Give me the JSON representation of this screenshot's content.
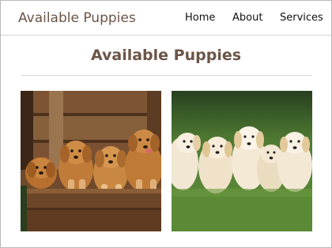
{
  "header": {
    "brand": "Available Puppies",
    "nav": [
      {
        "label": "Home"
      },
      {
        "label": "About"
      },
      {
        "label": "Services"
      }
    ]
  },
  "main": {
    "title": "Available Puppies"
  },
  "colors": {
    "brand": "#6b5548",
    "nav_text": "#111111",
    "divider": "#d9d9d9"
  }
}
